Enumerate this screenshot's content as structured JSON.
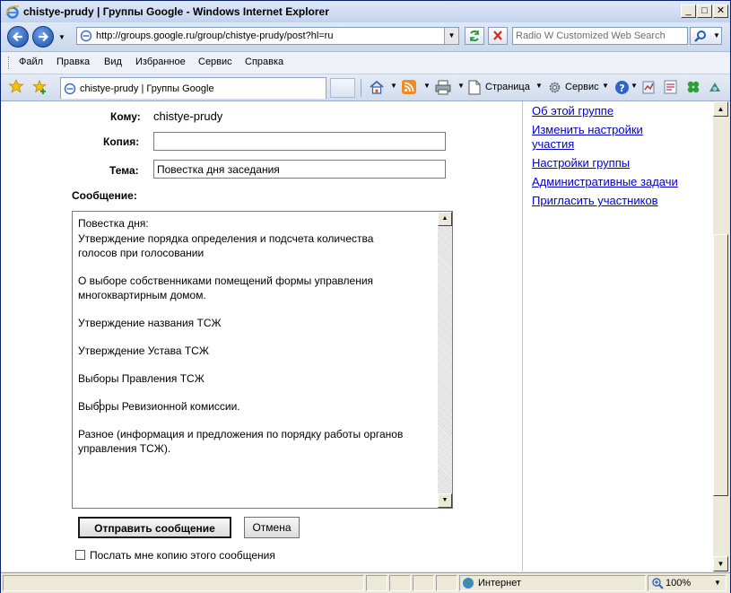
{
  "window": {
    "title": "chistye-prudy | Группы Google - Windows Internet Explorer"
  },
  "address_bar": {
    "url": "http://groups.google.ru/group/chistye-prudy/post?hl=ru",
    "search_placeholder": "Radio W Customized Web Search"
  },
  "menu": {
    "items": [
      "Файл",
      "Правка",
      "Вид",
      "Избранное",
      "Сервис",
      "Справка"
    ]
  },
  "tab_bar": {
    "active_tab": "chistye-prudy | Группы Google",
    "page_label": "Страница",
    "tools_label": "Сервис"
  },
  "form": {
    "to_label": "Кому:",
    "to_value": "chistye-prudy",
    "cc_label": "Копия:",
    "cc_value": "",
    "subject_label": "Тема:",
    "subject_value": "Повестка дня заседания",
    "message_label": "Сообщение:",
    "message_lines": [
      "Повестка дня:",
      "      Утверждение порядка определения и подсчета количества",
      "голосов при голосовании",
      "О выборе собственниками помещений формы управления",
      "многоквартирным домом.",
      "        Утверждение названия ТСЖ",
      "    Утверждение Устава ТСЖ",
      "Выборы Правления ТСЖ",
      "     Выборы Ревизионной комиссии.",
      "Разное (информация и предложения по порядку работы органов",
      "управления ТСЖ)."
    ],
    "send_button": "Отправить сообщение",
    "cancel_button": "Отмена",
    "copy_checkbox_label": "Послать мне копию этого сообщения",
    "copy_checked": false
  },
  "sidebar": {
    "links": [
      "Об этой группе",
      "Изменить настройки\nучастия",
      "Настройки группы",
      "Административные задачи",
      "Пригласить участников"
    ]
  },
  "status_bar": {
    "zone": "Интернет",
    "zoom": "100%"
  }
}
